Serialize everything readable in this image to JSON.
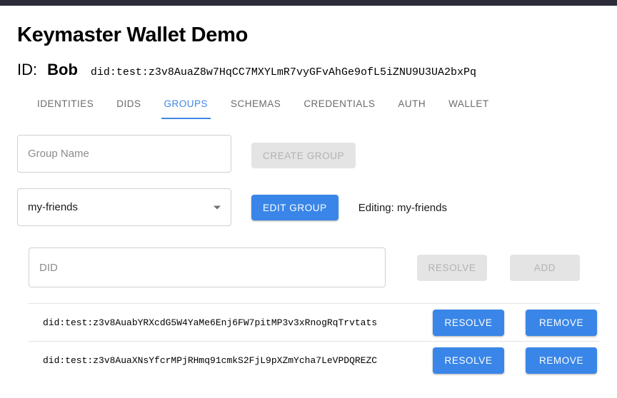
{
  "app": {
    "title": "Keymaster Wallet Demo"
  },
  "identity": {
    "label": "ID:",
    "name": "Bob",
    "did": "did:test:z3v8AuaZ8w7HqCC7MXYLmR7vyGFvAhGe9ofL5iZNU9U3UA2bxPq"
  },
  "tabs": [
    {
      "label": "IDENTITIES",
      "active": false
    },
    {
      "label": "DIDS",
      "active": false
    },
    {
      "label": "GROUPS",
      "active": true
    },
    {
      "label": "SCHEMAS",
      "active": false
    },
    {
      "label": "CREDENTIALS",
      "active": false
    },
    {
      "label": "AUTH",
      "active": false
    },
    {
      "label": "WALLET",
      "active": false
    }
  ],
  "groups": {
    "name_input": {
      "placeholder": "Group Name",
      "value": ""
    },
    "create_button": {
      "label": "CREATE GROUP",
      "disabled": true
    },
    "group_select": {
      "selected": "my-friends",
      "options": [
        "my-friends"
      ]
    },
    "edit_button": {
      "label": "EDIT GROUP",
      "disabled": false
    },
    "editing_status": "Editing: my-friends",
    "did_input": {
      "placeholder": "DID",
      "value": ""
    },
    "resolve_button": {
      "label": "RESOLVE",
      "disabled": true
    },
    "add_button": {
      "label": "ADD",
      "disabled": true
    },
    "member_actions": {
      "resolve_label": "RESOLVE",
      "remove_label": "REMOVE"
    },
    "members": [
      {
        "did": "did:test:z3v8AuabYRXcdG5W4YaMe6Enj6FW7pitMP3v3xRnogRqTrvtats"
      },
      {
        "did": "did:test:z3v8AuaXNsYfcrMPjRHmq91cmkS2FjL9pXZmYcha7LeVPDQREZC"
      }
    ]
  },
  "colors": {
    "accent": "#3986e8",
    "tab_active": "#3f88e5",
    "topbar": "#2b2b39",
    "disabled_bg": "#e4e4e4",
    "disabled_text": "#b2b2b2"
  }
}
